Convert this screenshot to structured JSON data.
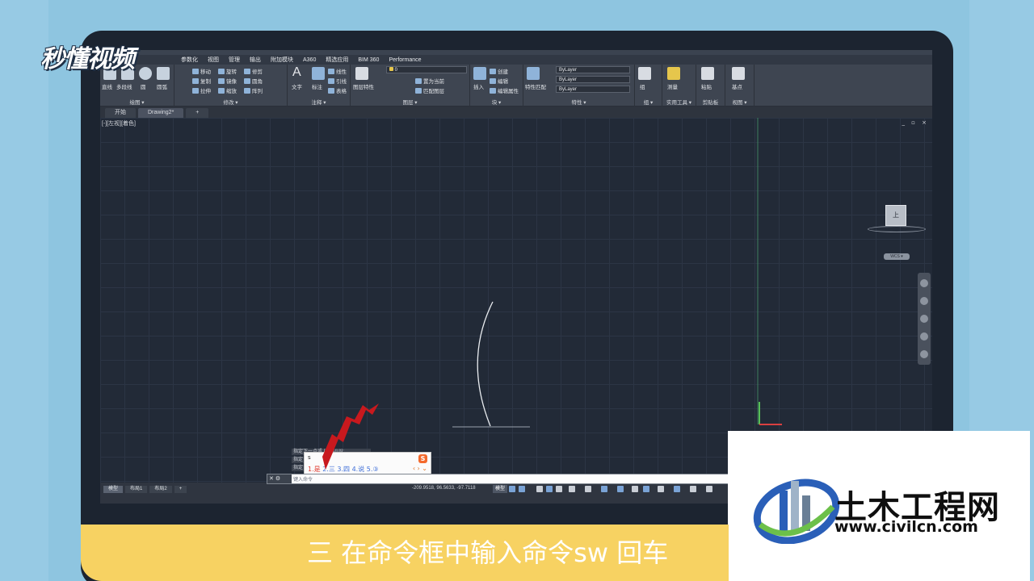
{
  "watermark": {
    "brand": "秒懂视频"
  },
  "menu": {
    "items": [
      "参数化",
      "视图",
      "管理",
      "输出",
      "附加模块",
      "A360",
      "精选应用",
      "BIM 360",
      "Performance"
    ]
  },
  "ribbon": {
    "draw": {
      "title": "绘图 ▾",
      "line": "直线",
      "polyline": "多段线",
      "circle": "圆",
      "arc": "圆弧"
    },
    "modify": {
      "title": "修改 ▾",
      "move": "移动",
      "rotate": "旋转",
      "trim": "修剪",
      "copy": "复制",
      "mirror": "镜像",
      "fillet": "圆角",
      "stretch": "拉伸",
      "scale": "缩放",
      "array": "阵列"
    },
    "annotation": {
      "title": "注释 ▾",
      "text": "文字",
      "dimension": "标注",
      "linear": "线性",
      "leader": "引线",
      "table": "表格"
    },
    "layers": {
      "title": "图层 ▾",
      "layer_props": "图层特性",
      "layer_value": "0",
      "set_current": "置为当前",
      "match_layer": "匹配图层"
    },
    "block": {
      "title": "块 ▾",
      "insert": "插入",
      "create": "创建",
      "edit": "编辑",
      "edit_attr": "编辑属性"
    },
    "properties": {
      "title": "特性 ▾",
      "match": "特性匹配",
      "color": "ByLayer",
      "linetype": "ByLayer",
      "lineweight": "ByLayer"
    },
    "groups": {
      "title": "组 ▾",
      "group": "组"
    },
    "utilities": {
      "title": "实用工具 ▾",
      "measure": "测量"
    },
    "clipboard": {
      "title": "剪贴板",
      "paste": "粘贴"
    },
    "view": {
      "title": "视图 ▾",
      "base": "基点"
    }
  },
  "doc_tabs": [
    "开始",
    "Drawing2*",
    "+"
  ],
  "viewport": {
    "label": "[-][左视][着色]",
    "controls": "_ ▫ ×"
  },
  "viewcube": {
    "face": "上",
    "wcs": "WCS ▾"
  },
  "command": {
    "history": [
      "指定下一点或 [放弃(U)]:",
      "指定",
      "指定"
    ],
    "prompt": "键入命令"
  },
  "ime": {
    "input": "s",
    "candidates": [
      {
        "label": "1.是",
        "first": true
      },
      {
        "label": "2.三",
        "first": false
      },
      {
        "label": "3.四",
        "first": false
      },
      {
        "label": "4.说",
        "first": false
      },
      {
        "label": "5.③",
        "first": false
      }
    ],
    "logo": "S",
    "nav": "‹ › ⌄"
  },
  "layout_tabs": [
    "模型",
    "布局1",
    "布局2",
    "+"
  ],
  "status": {
    "coords": "-209.9518, 96.5633, -97.7118",
    "model": "模型"
  },
  "civil": {
    "name": "土木工程网",
    "url": "www.civilcn.com"
  },
  "subtitle": "三 在命令框中输入命令sw 回车",
  "colors": {
    "background": "#8ec5e0",
    "subtitle_bar": "#f7d262",
    "canvas": "#222a37",
    "arrow": "#c8191e"
  }
}
